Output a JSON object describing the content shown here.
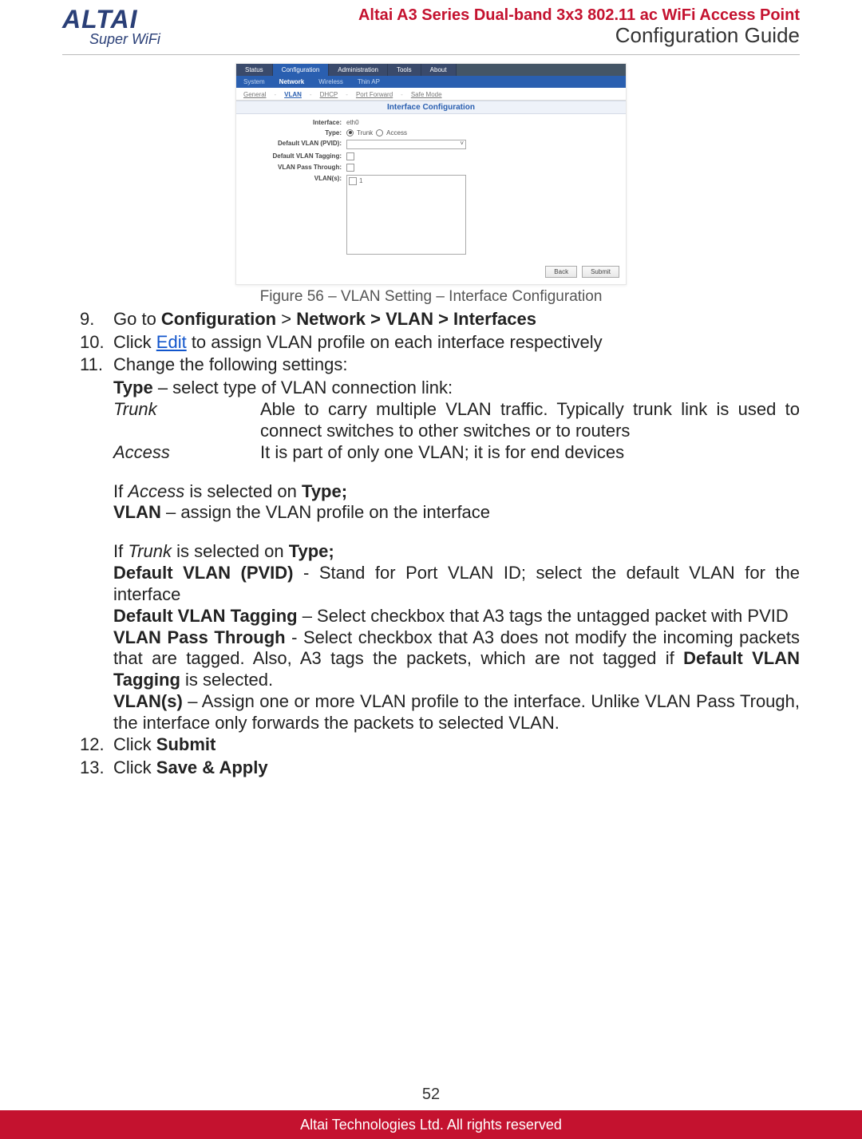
{
  "header": {
    "logo_main": "ALTAI",
    "logo_sub": "Super WiFi",
    "title_red": "Altai A3 Series Dual-band 3x3 802.11 ac WiFi Access Point",
    "title_sub": "Configuration Guide"
  },
  "ui": {
    "tabs1": {
      "status": "Status",
      "configuration": "Configuration",
      "administration": "Administration",
      "tools": "Tools",
      "about": "About"
    },
    "tabs2": {
      "system": "System",
      "network": "Network",
      "wireless": "Wireless",
      "thinap": "Thin AP"
    },
    "tabs3": {
      "general": "General",
      "vlan": "VLAN",
      "dhcp": "DHCP",
      "portfwd": "Port Forward",
      "safemode": "Safe Mode",
      "sep": "-"
    },
    "section_title": "Interface Configuration",
    "labels": {
      "interface": "Interface:",
      "type": "Type:",
      "pvid": "Default VLAN (PVID):",
      "tagging": "Default VLAN Tagging:",
      "passthrough": "VLAN Pass Through:",
      "vlans": "VLAN(s):"
    },
    "values": {
      "interface": "eth0",
      "type_trunk": "Trunk",
      "type_access": "Access",
      "vlan_item": "1"
    },
    "buttons": {
      "back": "Back",
      "submit": "Submit"
    }
  },
  "caption": "Figure 56 – VLAN Setting – Interface Configuration",
  "steps": {
    "s9_num": "9.",
    "s9_a": "Go to ",
    "s9_b": "Configuration",
    "s9_c": " > ",
    "s9_d": "Network > VLAN > Interfaces",
    "s10_num": "10.",
    "s10_a": "Click ",
    "s10_link": "Edit",
    "s10_b": " to assign VLAN profile on each interface respectively",
    "s11_num": "11.",
    "s11": "Change the following settings:",
    "type_line_a": "Type",
    "type_line_b": " – select type of VLAN connection link:",
    "def_trunk": "Trunk",
    "def_trunk_desc": "Able to carry multiple VLAN traffic. Typically trunk link is used to connect switches to other switches or to routers",
    "def_access": "Access",
    "def_access_desc": "It is part of only one VLAN; it is for end devices",
    "if_access_a": "If ",
    "if_access_b": "Access",
    "if_access_c": " is selected on ",
    "if_access_d": "Type;",
    "vlan_a": "VLAN",
    "vlan_b": " – assign the VLAN profile on the interface",
    "if_trunk_a": "If ",
    "if_trunk_b": "Trunk",
    "if_trunk_c": " is selected on ",
    "if_trunk_d": "Type;",
    "pvid_a": "Default VLAN (PVID)",
    "pvid_b": " - Stand for Port VLAN ID; select the default VLAN for the interface",
    "tag_a": "Default VLAN Tagging",
    "tag_b": " – Select checkbox that A3 tags the untagged packet with PVID",
    "pass_a": "VLAN Pass Through",
    "pass_b": " - Select checkbox that A3 does not modify the incoming packets that are tagged. Also, A3 tags the packets, which are not tagged if ",
    "pass_c": "Default VLAN Tagging",
    "pass_d": " is selected.",
    "vlans_a": "VLAN(s)",
    "vlans_b": " – Assign one or more VLAN profile to the interface. Unlike VLAN Pass Trough, the interface only forwards the packets to selected VLAN.",
    "s12_num": "12.",
    "s12_a": "Click ",
    "s12_b": "Submit",
    "s13_num": "13.",
    "s13_a": "Click ",
    "s13_b": "Save & Apply"
  },
  "page_number": "52",
  "footer": "Altai Technologies Ltd. All rights reserved"
}
